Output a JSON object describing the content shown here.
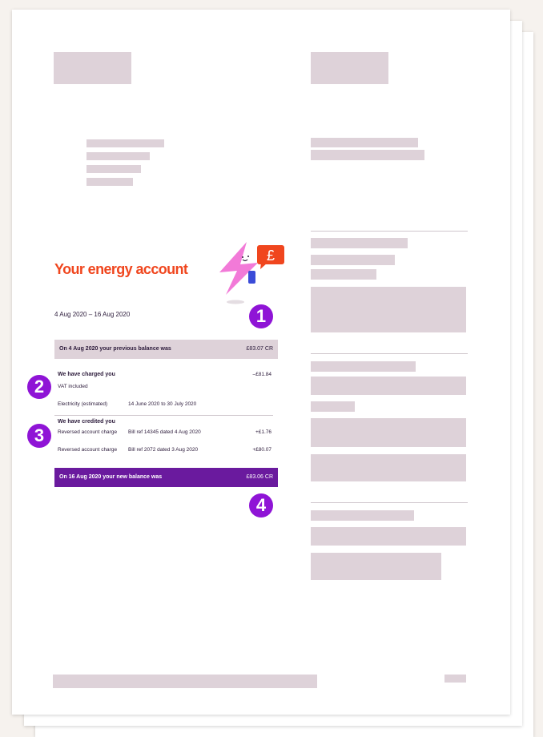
{
  "colors": {
    "accent_orange": "#f0461e",
    "balance_purple": "#6a1a9e",
    "badge_purple": "#8f14d6",
    "placeholder": "#ded2d9",
    "illustration_pink": "#f27ad8"
  },
  "account": {
    "title": "Your energy account",
    "period": "4 Aug 2020 – 16 Aug 2020"
  },
  "previous_balance": {
    "label": "On 4 Aug 2020 your previous balance was",
    "amount": "£83.07 CR"
  },
  "charges": {
    "heading": "We have charged you",
    "amount": "–£81.84",
    "vat_note": "VAT included",
    "line_label": "Electricity (estimated)",
    "line_period": "14 June 2020 to 30 July 2020"
  },
  "credits": {
    "heading": "We have credited you",
    "items": [
      {
        "label": "Reversed account charge",
        "ref": "Bill ref 14345 dated 4 Aug 2020",
        "amount": "+£1.76"
      },
      {
        "label": "Reversed account charge",
        "ref": "Bill ref 2072 dated 3 Aug 2020",
        "amount": "+£80.07"
      }
    ]
  },
  "new_balance": {
    "label": "On 16 Aug 2020 your new balance was",
    "amount": "£83.06 CR"
  },
  "badges": [
    "1",
    "2",
    "3",
    "4"
  ],
  "illustration": {
    "currency_symbol": "£",
    "icon": "lightning-bolt-mascot-icon"
  }
}
